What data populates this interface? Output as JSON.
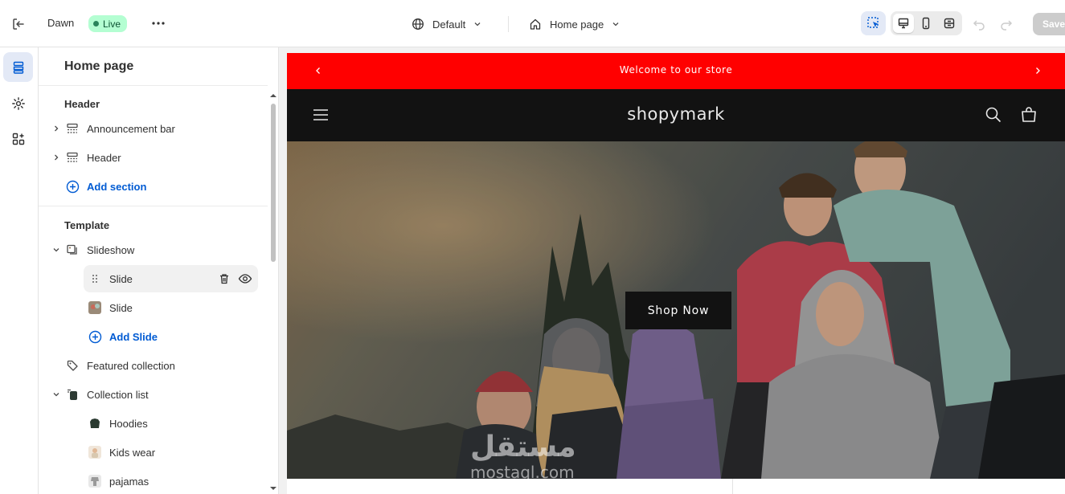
{
  "topbar": {
    "theme_name": "Dawn",
    "status": "Live",
    "template_selector": "Default",
    "page_selector": "Home page",
    "save_label": "Save"
  },
  "sidebar": {
    "title": "Home page",
    "header_group": "Header",
    "header_items": [
      {
        "label": "Announcement bar",
        "icon": "section-icon"
      },
      {
        "label": "Header",
        "icon": "section-icon"
      }
    ],
    "add_section": "Add section",
    "template_group": "Template",
    "template_items": {
      "slideshow": "Slideshow",
      "slides": [
        "Slide",
        "Slide"
      ],
      "add_slide": "Add Slide",
      "featured_collection": "Featured collection",
      "collection_list": "Collection list",
      "collections": [
        "Hoodies",
        "Kids wear",
        "pajamas"
      ]
    }
  },
  "preview": {
    "announcement": "Welcome to our store",
    "store_name": "shopymark",
    "hero_button": "Shop Now",
    "watermark_arabic": "مستقل",
    "watermark_latin": "mostaql.com"
  },
  "colors": {
    "announcement_bg": "#ff0000",
    "store_header_bg": "#121212",
    "accent_link": "#005bd3",
    "live_badge_bg": "#b4fed2"
  }
}
